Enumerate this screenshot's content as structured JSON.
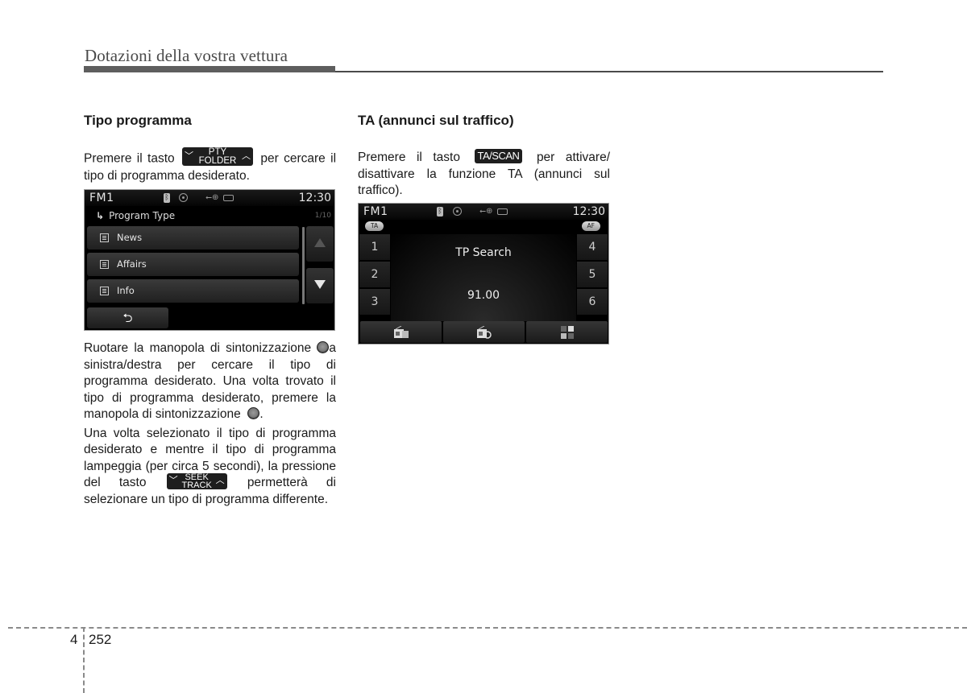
{
  "header": {
    "title": "Dotazioni della vostra vettura"
  },
  "left_section": {
    "title": "Tipo programma",
    "intro_before_key": "Premere il tasto",
    "key_pty": {
      "top": "PTY",
      "bottom": "FOLDER"
    },
    "intro_after_key": "per cercare il tipo di programma desiderato.",
    "para2_part1": "Ruotare la manopola di sintonizzazione",
    "para2_part2": "a sinistra/destra per cercare il tipo di programma desiderato. Una volta trovato il tipo di programma desiderato, premere la manopola di sintonizzazione",
    "para2_end": ".",
    "para3_before_key": "Una volta selezionato il tipo di programma desiderato e mentre il tipo di programma lampeggia (per circa 5 secondi), la pressione del tasto",
    "key_seek": {
      "top": "SEEK",
      "bottom": "TRACK"
    },
    "para3_after_key": "permetterà di selezionare un tipo di programma differente."
  },
  "screen1": {
    "band": "FM1",
    "time": "12:30",
    "status_icons": [
      "bluetooth-icon",
      "disc-icon",
      "usb-icon",
      "battery-icon"
    ],
    "title_icon": "program-type-icon",
    "title": "Program Type",
    "count": "1/10",
    "items": [
      {
        "label": "News",
        "icon": "list-icon"
      },
      {
        "label": "Affairs",
        "icon": "list-icon"
      },
      {
        "label": "Info",
        "icon": "list-icon"
      }
    ],
    "scroll_up_icon": "triangle-up-icon",
    "scroll_down_icon": "triangle-down-icon",
    "back_icon": "back-arrow-icon",
    "back_glyph": "⮌"
  },
  "right_section": {
    "title": "TA (annunci sul traffico)",
    "intro_before_key": "Premere il tasto",
    "key_ta": "TA/SCAN",
    "intro_after_key": "per attivare/ disattivare la funzione TA (annunci sul traffico)."
  },
  "screen2": {
    "band": "FM1",
    "time": "12:30",
    "ta_label": "TA",
    "af_label": "AF",
    "presets_left": [
      "1",
      "2",
      "3"
    ],
    "presets_right": [
      "4",
      "5",
      "6"
    ],
    "status_message": "TP Search",
    "frequency": "91.00",
    "bottom_buttons": [
      "radio-save-icon",
      "radio-scan-icon",
      "menu-grid-icon"
    ]
  },
  "footer": {
    "chapter": "4",
    "page": "252"
  },
  "colors": {
    "header_bar": "#5e5e5e",
    "keycap_bg": "#1e1e1e",
    "screen_bg": "#000000",
    "dash_line": "#8a8a8a"
  }
}
